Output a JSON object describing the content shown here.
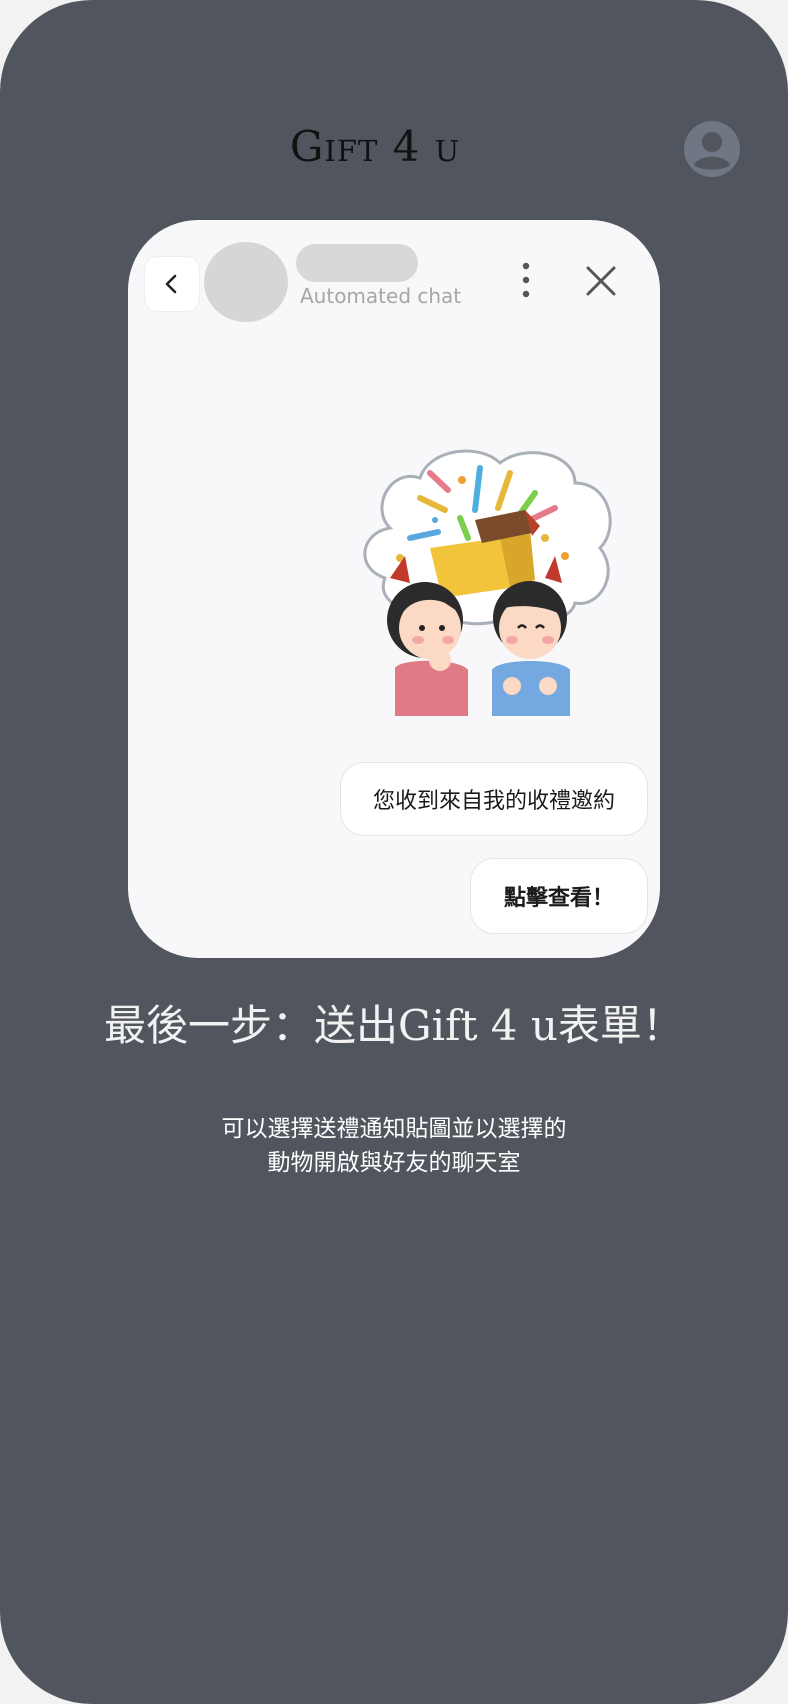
{
  "header": {
    "app_title": "Gift 4 u",
    "account_icon": "user-circle-icon"
  },
  "chat_preview": {
    "back_icon": "chevron-left-icon",
    "subtitle": "Automated chat",
    "more_icon": "more-vertical-icon",
    "close_icon": "close-icon",
    "sticker": "gift-box-sticker",
    "messages": [
      "您收到來自我的收禮邀約",
      "點擊查看！"
    ]
  },
  "step": {
    "heading": "最後一步：送出Gift 4 u表單！",
    "description_lines": [
      "可以選擇送禮通知貼圖並以選擇的",
      "動物開啟與好友的聊天室"
    ]
  },
  "colors": {
    "phone_background": "#51555d",
    "card_background": "#f8f8fa",
    "avatar_placeholder": "#d6d6d6"
  }
}
